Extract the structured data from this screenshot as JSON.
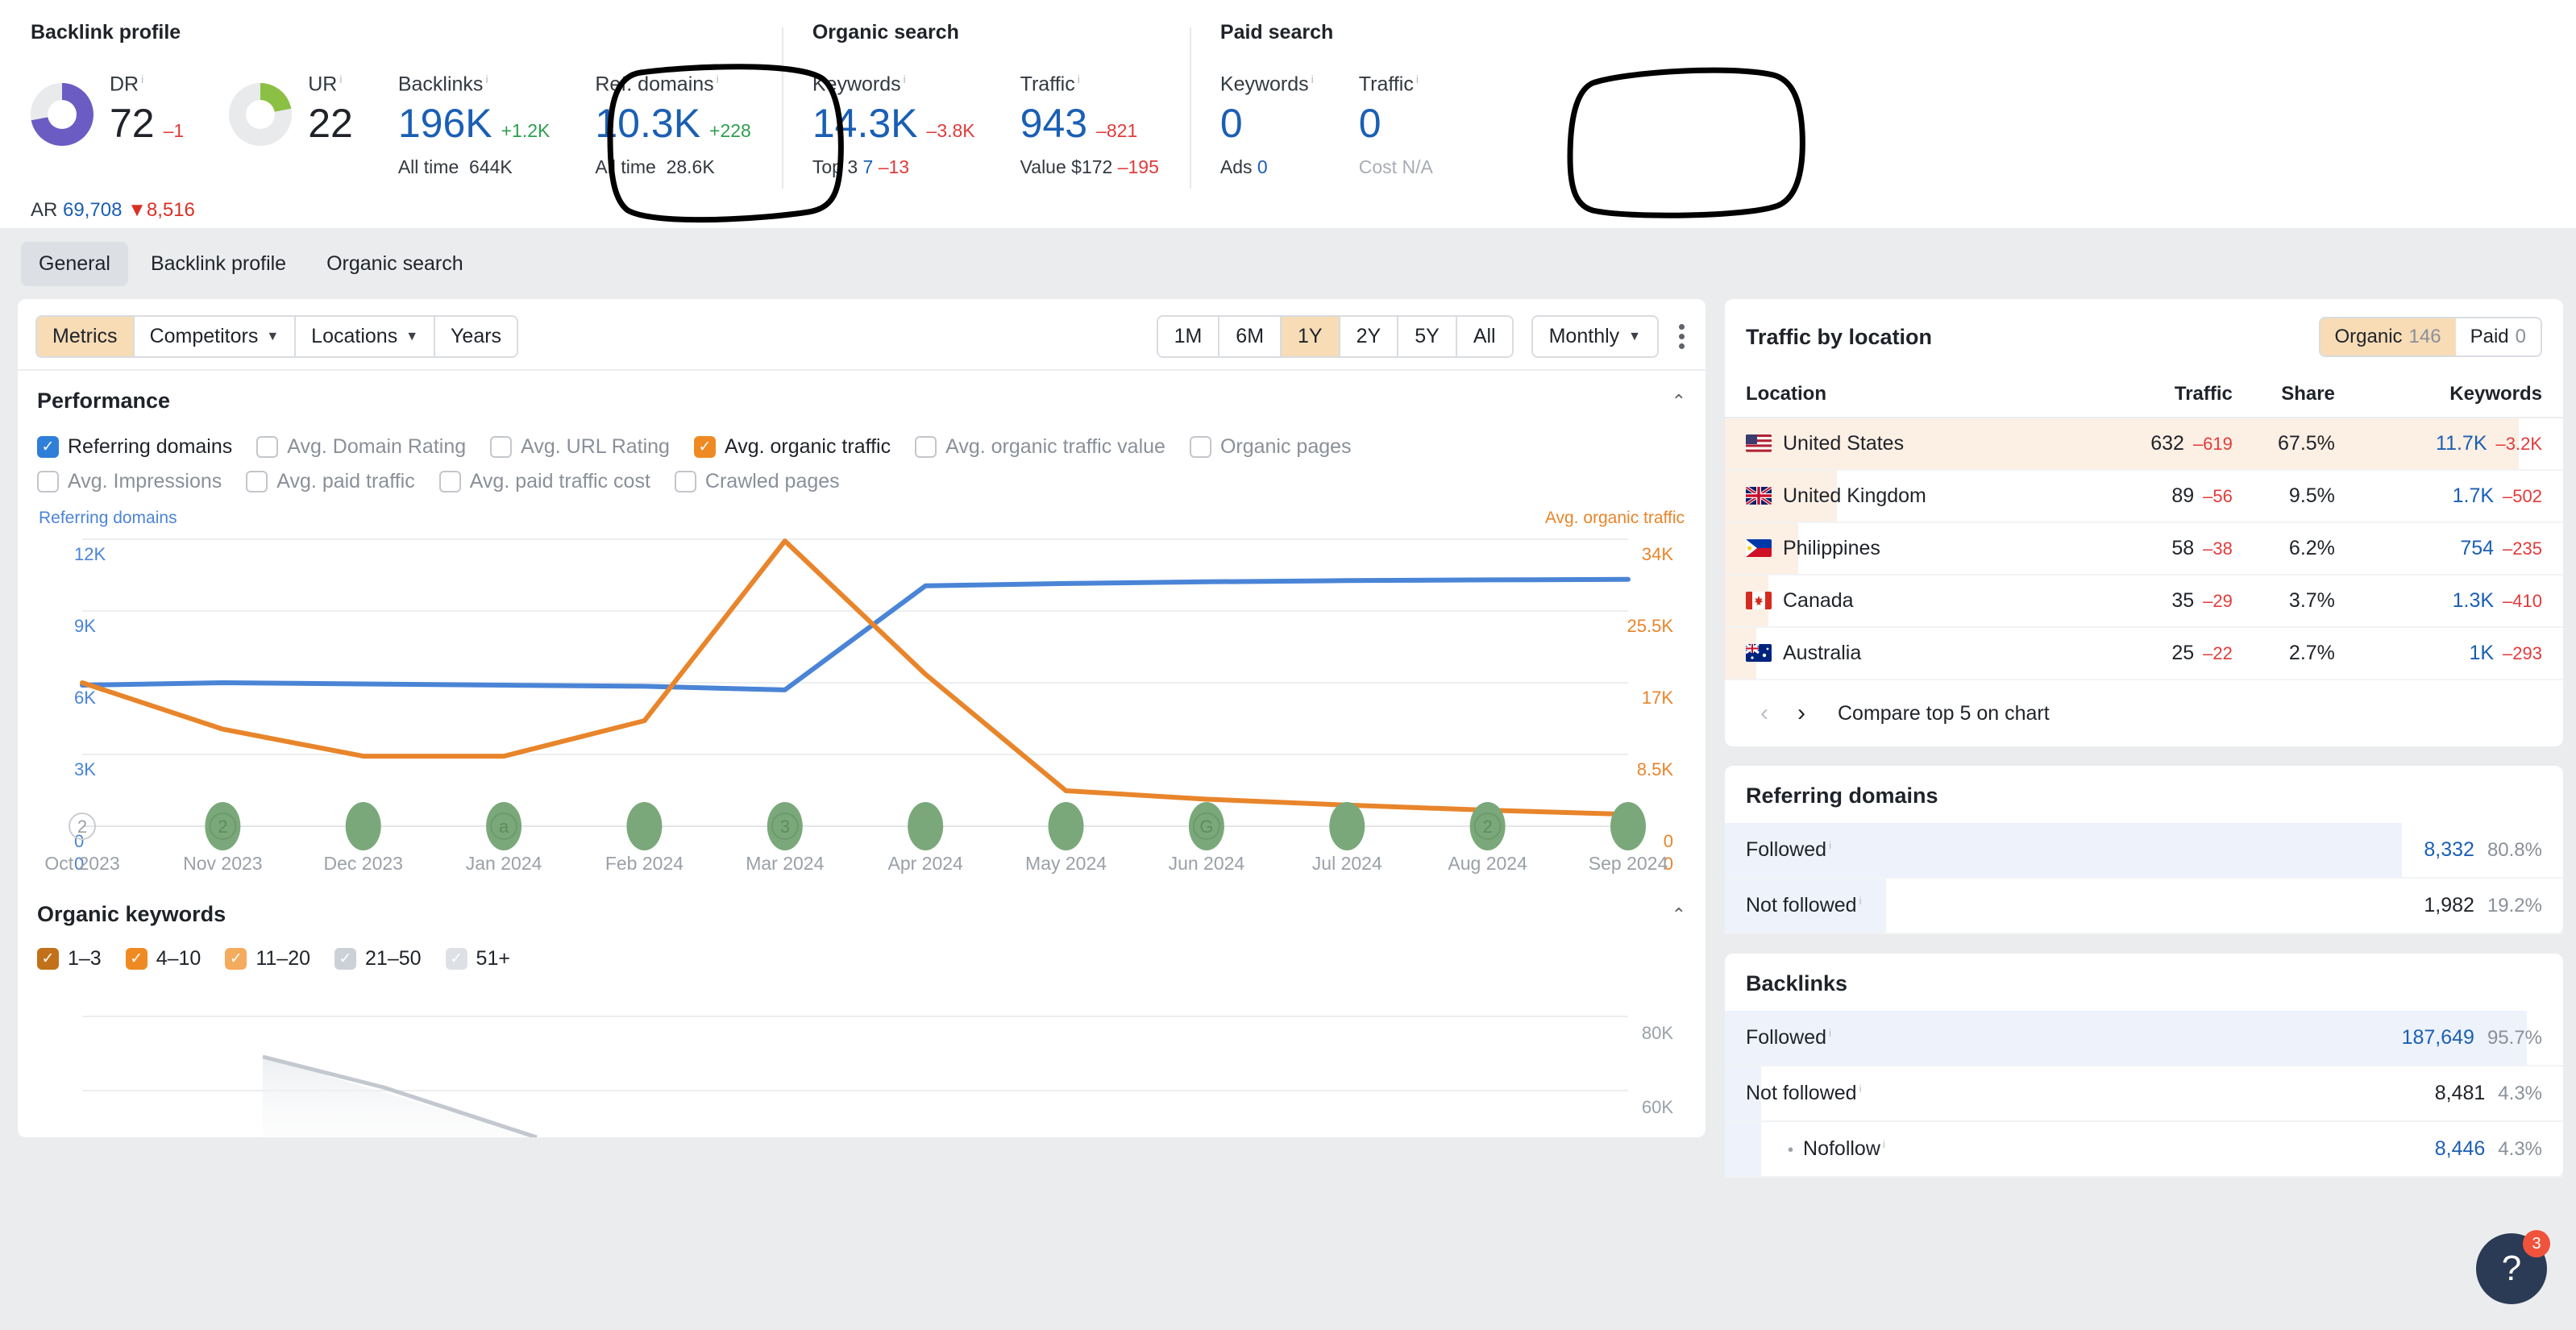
{
  "backlink_profile": {
    "title": "Backlink profile",
    "dr": {
      "label": "DR",
      "value": "72",
      "delta": "–1",
      "ar_label": "AR",
      "ar_value": "69,708",
      "ar_delta": "▼8,516",
      "percent": 72,
      "color": "#6b5cc4"
    },
    "ur": {
      "label": "UR",
      "value": "22",
      "percent": 22,
      "color": "#8cc045"
    },
    "backlinks": {
      "label": "Backlinks",
      "value": "196K",
      "delta": "+1.2K",
      "sub_label": "All time",
      "sub_value": "644K",
      "annotated": true
    },
    "ref_domains": {
      "label": "Ref. domains",
      "value": "10.3K",
      "delta": "+228",
      "sub_label": "All time",
      "sub_value": "28.6K"
    }
  },
  "organic_search": {
    "title": "Organic search",
    "keywords": {
      "label": "Keywords",
      "value": "14.3K",
      "delta": "–3.8K",
      "sub_label": "Top 3",
      "sub_value": "7",
      "sub_delta": "–13"
    },
    "traffic": {
      "label": "Traffic",
      "value": "943",
      "delta": "–821",
      "sub_label": "Value",
      "sub_value": "$172",
      "sub_delta": "–195",
      "annotated": true
    }
  },
  "paid_search": {
    "title": "Paid search",
    "keywords": {
      "label": "Keywords",
      "value": "0",
      "sub_label": "Ads",
      "sub_value": "0"
    },
    "traffic": {
      "label": "Traffic",
      "value": "0",
      "sub_label": "Cost",
      "sub_value": "N/A"
    }
  },
  "tabs": [
    {
      "label": "General",
      "active": true
    },
    {
      "label": "Backlink profile",
      "active": false
    },
    {
      "label": "Organic search",
      "active": false
    }
  ],
  "toolbar": {
    "filters": [
      {
        "label": "Metrics",
        "caret": false,
        "active": true
      },
      {
        "label": "Competitors",
        "caret": true,
        "active": false
      },
      {
        "label": "Locations",
        "caret": true,
        "active": false
      },
      {
        "label": "Years",
        "caret": false,
        "active": false
      }
    ],
    "ranges": [
      {
        "label": "1M",
        "active": false
      },
      {
        "label": "6M",
        "active": false
      },
      {
        "label": "1Y",
        "active": true
      },
      {
        "label": "2Y",
        "active": false
      },
      {
        "label": "5Y",
        "active": false
      },
      {
        "label": "All",
        "active": false
      }
    ],
    "frequency": "Monthly",
    "kebab": "more-options"
  },
  "performance": {
    "title": "Performance",
    "metrics": [
      {
        "label": "Referring domains",
        "checked": true,
        "color": "#2f7ed8"
      },
      {
        "label": "Avg. Domain Rating",
        "checked": false,
        "color": ""
      },
      {
        "label": "Avg. URL Rating",
        "checked": false,
        "color": ""
      },
      {
        "label": "Avg. organic traffic",
        "checked": true,
        "color": "#ef8a22"
      },
      {
        "label": "Avg. organic traffic value",
        "checked": false,
        "color": ""
      },
      {
        "label": "Organic pages",
        "checked": false,
        "color": ""
      },
      {
        "label": "Avg. Impressions",
        "checked": false,
        "color": ""
      },
      {
        "label": "Avg. paid traffic",
        "checked": false,
        "color": ""
      },
      {
        "label": "Avg. paid traffic cost",
        "checked": false,
        "color": ""
      },
      {
        "label": "Crawled pages",
        "checked": false,
        "color": ""
      }
    ]
  },
  "chart_data": {
    "type": "line",
    "title": "Performance",
    "x": [
      "Oct 2023",
      "Nov 2023",
      "Dec 2023",
      "Jan 2024",
      "Feb 2024",
      "Mar 2024",
      "Apr 2024",
      "May 2024",
      "Jun 2024",
      "Jul 2024",
      "Aug 2024",
      "Sep 2024"
    ],
    "series": [
      {
        "name": "Referring domains",
        "color": "#4a84d6",
        "axis": "left",
        "values": [
          5900,
          6000,
          5950,
          5900,
          5850,
          5700,
          10050,
          10150,
          10220,
          10270,
          10300,
          10320
        ]
      },
      {
        "name": "Avg. organic traffic",
        "color": "#e8852b",
        "axis": "right",
        "values": [
          17000,
          11500,
          8300,
          8300,
          12500,
          33800,
          18000,
          4200,
          3200,
          2500,
          1900,
          1400
        ]
      }
    ],
    "left_axis": {
      "label": "Referring domains",
      "color": "#4a84d6",
      "ticks": [
        "12K",
        "9K",
        "6K",
        "3K",
        "0"
      ],
      "min": 0,
      "max": 12000
    },
    "right_axis": {
      "label": "Avg. organic traffic",
      "color": "#e8852b",
      "ticks": [
        "34K",
        "25.5K",
        "17K",
        "8.5K",
        "0"
      ],
      "min": 0,
      "max": 34000
    },
    "grid": true,
    "update_markers": [
      {
        "x": "Oct 2023",
        "glyph": "2",
        "filled": false
      },
      {
        "x": "Nov 2023",
        "glyph": "2",
        "filled": true
      },
      {
        "x": "Dec 2023",
        "glyph": "",
        "filled": true
      },
      {
        "x": "Jan 2024",
        "glyph": "a",
        "filled": true
      },
      {
        "x": "Feb 2024",
        "glyph": "",
        "filled": true
      },
      {
        "x": "Mar 2024",
        "glyph": "3",
        "filled": true
      },
      {
        "x": "Apr 2024",
        "glyph": "",
        "filled": true
      },
      {
        "x": "May 2024",
        "glyph": "",
        "filled": true
      },
      {
        "x": "Jun 2024",
        "glyph": "G",
        "filled": true
      },
      {
        "x": "Jul 2024",
        "glyph": "",
        "filled": true
      },
      {
        "x": "Aug 2024",
        "glyph": "2",
        "filled": true
      },
      {
        "x": "Sep 2024",
        "glyph": "",
        "filled": true
      }
    ]
  },
  "organic_keywords": {
    "title": "Organic keywords",
    "buckets": [
      {
        "label": "1–3",
        "checked": true,
        "color": "#c2701a"
      },
      {
        "label": "4–10",
        "checked": true,
        "color": "#ef8a22"
      },
      {
        "label": "11–20",
        "checked": true,
        "color": "#f4ab5e"
      },
      {
        "label": "21–50",
        "checked": true,
        "color": "#ccd1d8"
      },
      {
        "label": "51+",
        "checked": true,
        "color": "#dde1e6"
      }
    ],
    "axis_ticks": [
      "80K",
      "60K"
    ]
  },
  "traffic_by_location": {
    "title": "Traffic by location",
    "toggle": [
      {
        "label": "Organic",
        "count": "146",
        "active": true
      },
      {
        "label": "Paid",
        "count": "0",
        "active": false
      }
    ],
    "columns": [
      "Location",
      "Traffic",
      "Share",
      "Keywords"
    ],
    "rows": [
      {
        "location": "United States",
        "flag": "us-flag",
        "traffic": "632",
        "traffic_delta": "–619",
        "share": "67.5%",
        "share_pct": 67.5,
        "keywords": "11.7K",
        "keywords_delta": "–3.2K"
      },
      {
        "location": "United Kingdom",
        "flag": "gb-flag",
        "traffic": "89",
        "traffic_delta": "–56",
        "share": "9.5%",
        "share_pct": 9.5,
        "keywords": "1.7K",
        "keywords_delta": "–502"
      },
      {
        "location": "Philippines",
        "flag": "ph-flag",
        "traffic": "58",
        "traffic_delta": "–38",
        "share": "6.2%",
        "share_pct": 6.2,
        "keywords": "754",
        "keywords_delta": "–235"
      },
      {
        "location": "Canada",
        "flag": "ca-flag",
        "traffic": "35",
        "traffic_delta": "–29",
        "share": "3.7%",
        "share_pct": 3.7,
        "keywords": "1.3K",
        "keywords_delta": "–410"
      },
      {
        "location": "Australia",
        "flag": "au-flag",
        "traffic": "25",
        "traffic_delta": "–22",
        "share": "2.7%",
        "share_pct": 2.7,
        "keywords": "1K",
        "keywords_delta": "–293"
      }
    ],
    "pager": {
      "prev": "‹",
      "next": "›",
      "text": "Compare top 5 on chart"
    }
  },
  "referring_domains_panel": {
    "title": "Referring domains",
    "rows": [
      {
        "label": "Followed",
        "value": "8,332",
        "pct": "80.8%",
        "bar": 80.8,
        "blue_value": true,
        "indent": false,
        "bullet": false
      },
      {
        "label": "Not followed",
        "value": "1,982",
        "pct": "19.2%",
        "bar": 19.2,
        "blue_value": false,
        "indent": false,
        "bullet": false
      }
    ]
  },
  "backlinks_panel": {
    "title": "Backlinks",
    "rows": [
      {
        "label": "Followed",
        "value": "187,649",
        "pct": "95.7%",
        "bar": 95.7,
        "blue_value": true,
        "indent": false,
        "bullet": false
      },
      {
        "label": "Not followed",
        "value": "8,481",
        "pct": "4.3%",
        "bar": 4.3,
        "blue_value": false,
        "indent": false,
        "bullet": false
      },
      {
        "label": "Nofollow",
        "value": "8,446",
        "pct": "4.3%",
        "bar": 4.3,
        "blue_value": true,
        "indent": true,
        "bullet": true
      }
    ]
  },
  "help": {
    "glyph": "?",
    "badge": "3"
  }
}
